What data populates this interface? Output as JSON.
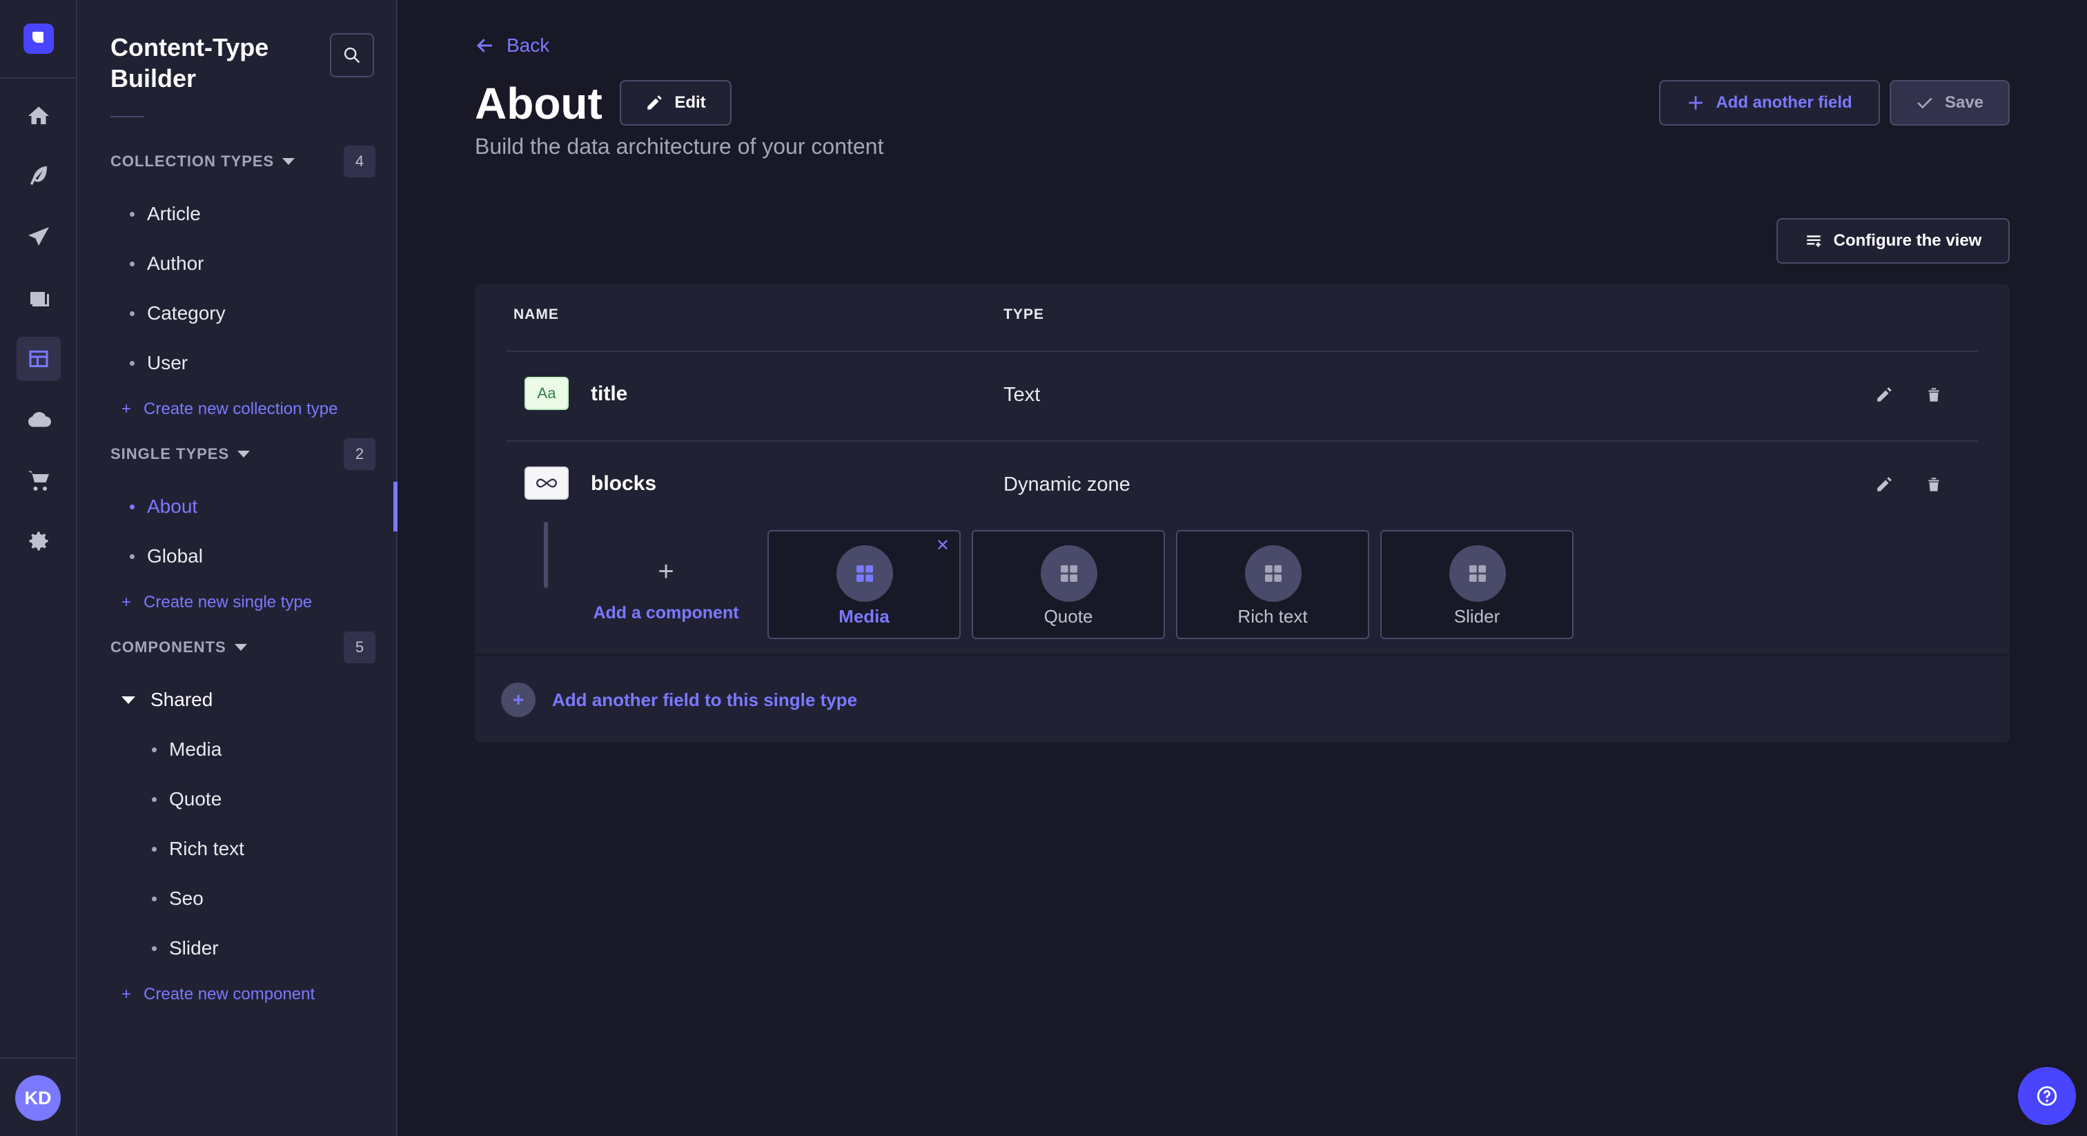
{
  "sidebar": {
    "title": "Content-Type Builder",
    "collection_types": {
      "label": "COLLECTION TYPES",
      "count": "4",
      "items": [
        "Article",
        "Author",
        "Category",
        "User"
      ],
      "create": "Create new collection type"
    },
    "single_types": {
      "label": "SINGLE TYPES",
      "count": "2",
      "items": [
        "About",
        "Global"
      ],
      "active": "About",
      "create": "Create new single type"
    },
    "components": {
      "label": "COMPONENTS",
      "count": "5",
      "group": "Shared",
      "items": [
        "Media",
        "Quote",
        "Rich text",
        "Seo",
        "Slider"
      ],
      "create": "Create new component"
    }
  },
  "user": {
    "initials": "KD"
  },
  "header": {
    "back": "Back",
    "title": "About",
    "edit": "Edit",
    "subtitle": "Build the data architecture of your content",
    "add_field": "Add another field",
    "save": "Save",
    "configure": "Configure the view"
  },
  "table": {
    "columns": [
      "NAME",
      "TYPE"
    ],
    "rows": [
      {
        "icon": "text-field-icon",
        "icon_text": "Aa",
        "name": "title",
        "type": "Text"
      },
      {
        "icon": "dynamic-zone-icon",
        "name": "blocks",
        "type": "Dynamic zone"
      }
    ],
    "dynamic_zone": {
      "add_component": "Add a component",
      "components": [
        "Media",
        "Quote",
        "Rich text",
        "Slider"
      ],
      "selected": "Media"
    },
    "add_another": "Add another field to this single type"
  },
  "colors": {
    "accent": "#7b79ff",
    "brand": "#4945ff",
    "background": "#181826",
    "surface": "#212134"
  }
}
